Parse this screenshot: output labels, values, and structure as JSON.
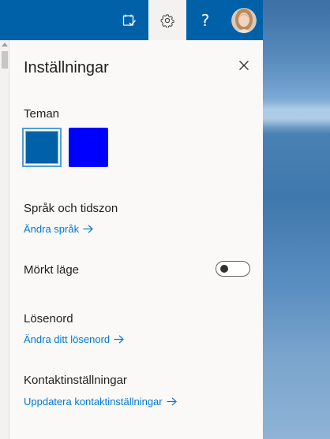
{
  "topbar": {
    "help_label": "?",
    "icons": [
      "tasks-check-icon",
      "gear-icon",
      "help-icon",
      "profile-avatar"
    ]
  },
  "panel": {
    "title": "Inställningar",
    "close_icon": "close-icon"
  },
  "themes": {
    "heading": "Teman",
    "swatches": [
      {
        "color": "#0061a9",
        "selected": true
      },
      {
        "color": "#0000ff",
        "selected": false
      }
    ]
  },
  "language": {
    "heading": "Språk och tidszon",
    "link": "Ändra språk"
  },
  "dark_mode": {
    "heading": "Mörkt läge",
    "enabled": false
  },
  "password": {
    "heading": "Lösenord",
    "link": "Ändra ditt lösenord"
  },
  "contact": {
    "heading": "Kontaktinställningar",
    "link": "Uppdatera kontaktinställningar"
  },
  "colors": {
    "topbar": "#0061a9",
    "link": "#0078d4",
    "panel_bg": "#faf9f8"
  }
}
